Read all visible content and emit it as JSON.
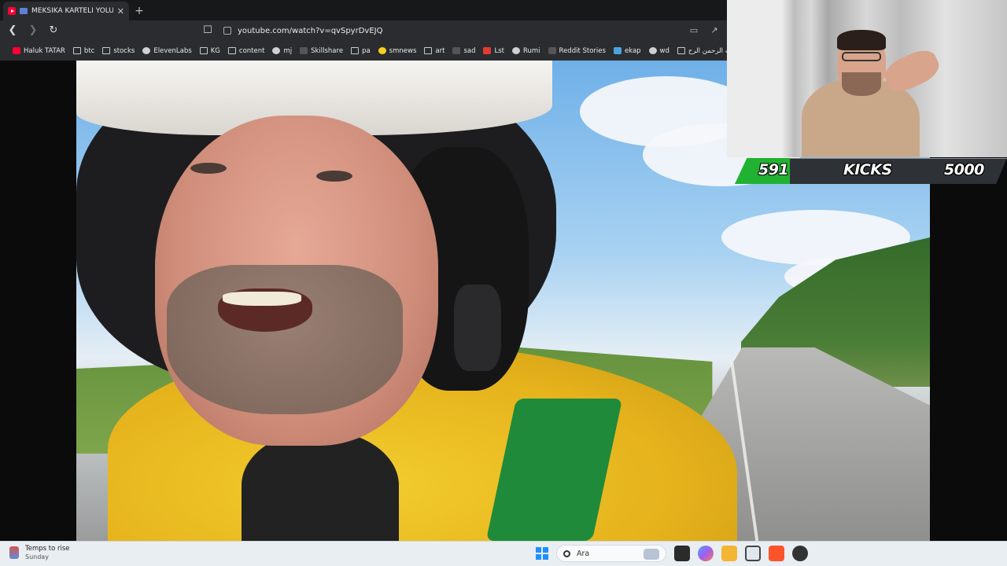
{
  "browser": {
    "tab_title": "MEKSİKA KARTELİ YOLUMUZU",
    "address": "youtube.com/watch?v=qvSpyrDvEJQ",
    "bookmarks": [
      {
        "label": "Haluk TATAR",
        "icon": "youtube-icon"
      },
      {
        "label": "btc",
        "icon": "folder-icon"
      },
      {
        "label": "stocks",
        "icon": "folder-icon"
      },
      {
        "label": "ElevenLabs",
        "icon": "elevenlabs-icon"
      },
      {
        "label": "KG",
        "icon": "folder-icon"
      },
      {
        "label": "content",
        "icon": "folder-icon"
      },
      {
        "label": "mj",
        "icon": "github-icon"
      },
      {
        "label": "Skillshare",
        "icon": "skillshare-icon"
      },
      {
        "label": "pa",
        "icon": "folder-icon"
      },
      {
        "label": "smnews",
        "icon": "smiley-icon"
      },
      {
        "label": "art",
        "icon": "folder-icon"
      },
      {
        "label": "sad",
        "icon": "slash-icon"
      },
      {
        "label": "Lst",
        "icon": "s-logo-icon"
      },
      {
        "label": "Rumi",
        "icon": "globe-icon"
      },
      {
        "label": "Reddit Stories",
        "icon": "d-logo-icon"
      },
      {
        "label": "ekap",
        "icon": "bird-icon"
      },
      {
        "label": "wd",
        "icon": "wikipedia-icon"
      },
      {
        "label": "الله الرحمن الرح...",
        "icon": "document-icon"
      }
    ]
  },
  "overlay": {
    "goal_current": "591",
    "goal_label": "KICKS",
    "goal_target": "5000",
    "progress_fraction": 0.118
  },
  "taskbar": {
    "weather_title": "Temps to rise",
    "weather_subtitle": "Sunday",
    "search_placeholder": "Ara"
  },
  "colors": {
    "goal_green": "#22b232",
    "taskbar_bg": "#e9eef3",
    "browser_bg": "#2b2c2f"
  }
}
